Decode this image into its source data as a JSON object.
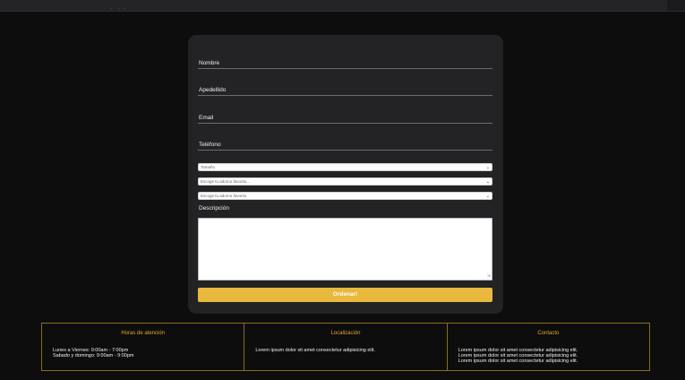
{
  "browser": {
    "dots": ". . ."
  },
  "form": {
    "fields": [
      {
        "label": "Nombre"
      },
      {
        "label": "Apedellido"
      },
      {
        "label": "Email"
      },
      {
        "label": "Teléfono"
      }
    ],
    "selects": [
      {
        "value": "Tamaño"
      },
      {
        "value": "Escoge tu adorno favorito..."
      },
      {
        "value": "Escoge tu adorno favorito"
      }
    ],
    "description_label": "Descripción",
    "submit_label": "Ordenar!"
  },
  "footer": {
    "columns": [
      {
        "title": "Horas de atención",
        "lines": [
          "Lunes a Viernes: 9:00am - 7:00pm",
          "Sabado y domingo: 9:00am - 9:00pm"
        ]
      },
      {
        "title": "Localización",
        "lines": [
          "Lorem ipsum dolor sit amet consectetur adipisicing elit."
        ]
      },
      {
        "title": "Contacto",
        "lines": [
          "Lorem ipsum dolor sit amet consectetur adipisicing elit.",
          "Lorem ipsum dolor sit amet consectetur adipisicing elit.",
          "Lorem ipsum dolor sit amet consectetur adipisicing elit."
        ]
      }
    ]
  },
  "colors": {
    "accent": "#e8b93c",
    "footer_border": "#8a6d1e",
    "background": "#0d0d0e",
    "card": "#232325"
  }
}
